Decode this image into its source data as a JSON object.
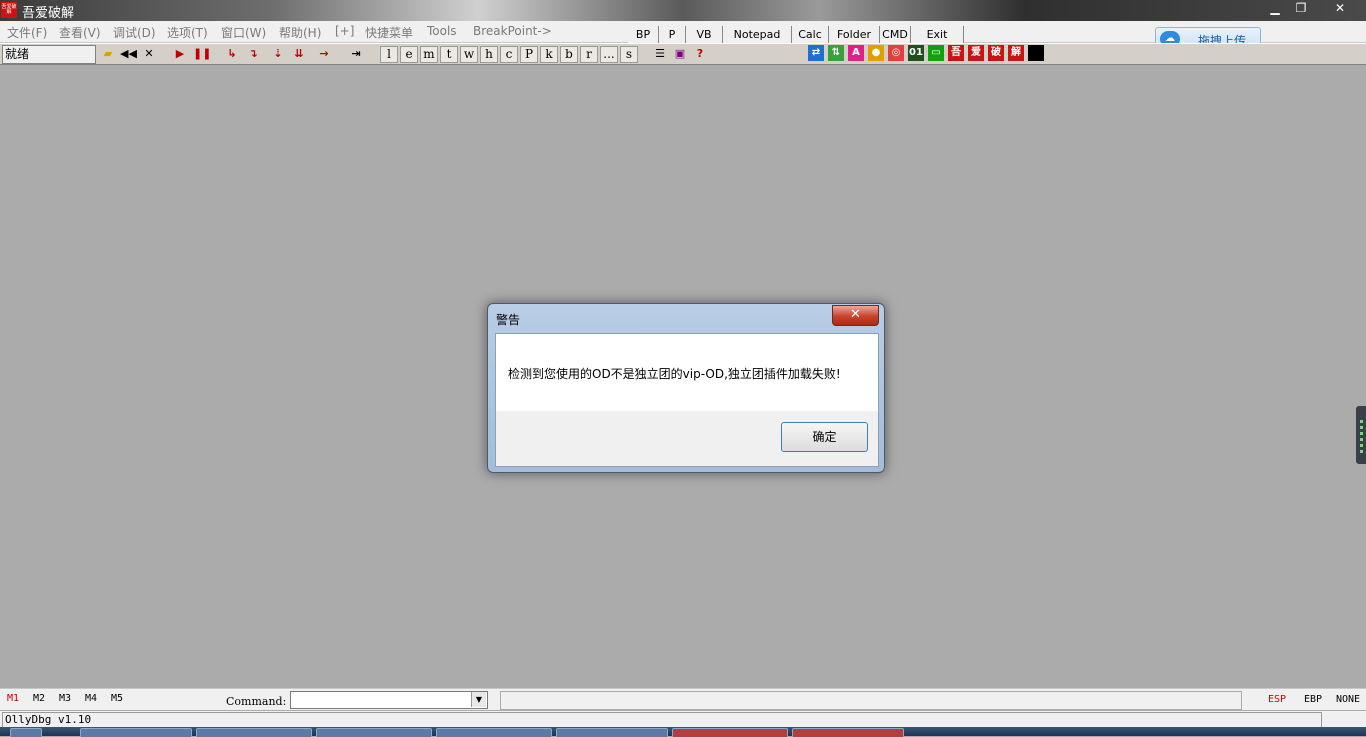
{
  "window": {
    "title": "吾爱破解",
    "icon_text": "吾爱破解",
    "controls": {
      "minimize": "▁",
      "restore": "❐",
      "close": "✕"
    }
  },
  "menu": {
    "items": [
      "文件(F)",
      "查看(V)",
      "调试(D)",
      "选项(T)",
      "窗口(W)",
      "帮助(H)",
      "[+]",
      "快捷菜单",
      "Tools",
      "BreakPoint->"
    ]
  },
  "quick_buttons": [
    "BP",
    "P",
    "VB",
    "Notepad",
    "Calc",
    "Folder",
    "CMD",
    "Exit"
  ],
  "upload": {
    "label": "拖拽上传",
    "icon": "cloud-icon"
  },
  "toolbar": {
    "status": "就绪",
    "letters": [
      "l",
      "e",
      "m",
      "t",
      "w",
      "h",
      "c",
      "P",
      "k",
      "b",
      "r",
      "...",
      "s"
    ],
    "brand_icons": [
      "吾",
      "爱",
      "破",
      "解"
    ]
  },
  "dialog": {
    "title": "警告",
    "close_label": "✕",
    "message": "检测到您使用的OD不是独立团的vip-OD,独立团插件加载失败!",
    "ok_label": "确定"
  },
  "command_bar": {
    "memory_tabs": [
      "M1",
      "M2",
      "M3",
      "M4",
      "M5"
    ],
    "label": "Command:",
    "input_value": "",
    "registers": [
      "ESP",
      "EBP",
      "NONE"
    ],
    "colors": {
      "active": "#cc0000",
      "normal": "#000000"
    }
  },
  "statusbar": {
    "text": "OllyDbg v1.10"
  }
}
